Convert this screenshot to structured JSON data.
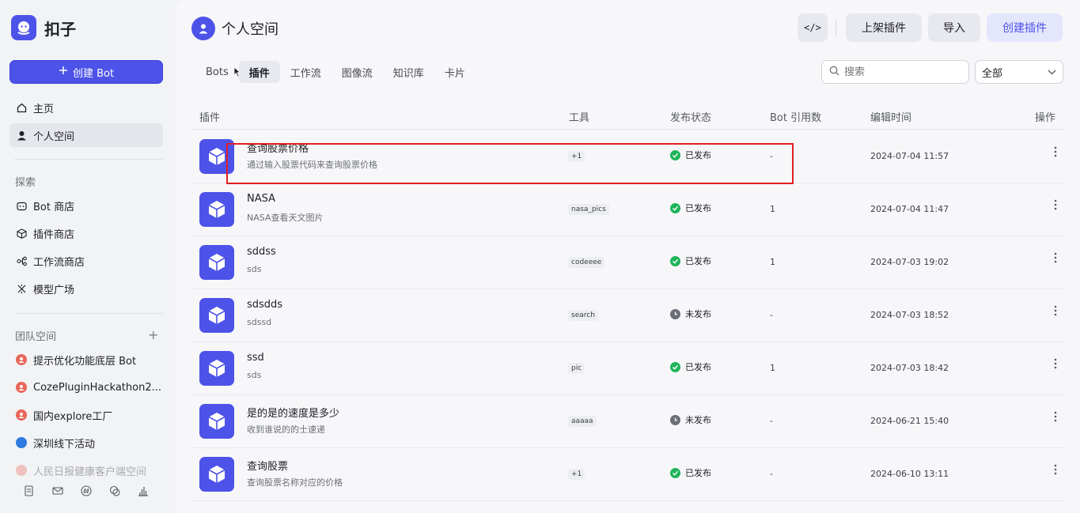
{
  "brand": {
    "name": "扣子"
  },
  "sidebar": {
    "create_bot_label": "创建 Bot",
    "nav": [
      {
        "label": "主页",
        "icon": "home-icon"
      },
      {
        "label": "个人空间",
        "icon": "person-icon",
        "active": true
      }
    ],
    "explore_label": "探索",
    "explore": [
      {
        "label": "Bot 商店",
        "icon": "bot-store-icon"
      },
      {
        "label": "插件商店",
        "icon": "cube-icon"
      },
      {
        "label": "工作流商店",
        "icon": "workflow-icon"
      },
      {
        "label": "模型广场",
        "icon": "model-icon"
      }
    ],
    "team_label": "团队空间",
    "teams": [
      {
        "label": "提示优化功能底层 Bot"
      },
      {
        "label": "CozePluginHackathon2..."
      },
      {
        "label": "国内explore工厂"
      },
      {
        "label": "深圳线下活动"
      },
      {
        "label": "人民日报健康客户端空间"
      }
    ]
  },
  "header": {
    "title": "个人空间",
    "code_btn": "</>",
    "publish_btn": "上架插件",
    "import_btn": "导入",
    "create_btn": "创建插件"
  },
  "tabs": [
    "Bots",
    "插件",
    "工作流",
    "图像流",
    "知识库",
    "卡片"
  ],
  "search": {
    "placeholder": "搜索",
    "value": ""
  },
  "filter": {
    "selected": "全部"
  },
  "table": {
    "columns": [
      "插件",
      "工具",
      "发布状态",
      "Bot 引用数",
      "编辑时间",
      "操作"
    ],
    "rows": [
      {
        "name": "查询股票价格",
        "desc": "通过输入股票代码来查询股票价格",
        "tool": "+1",
        "status": "已发布",
        "published": true,
        "refs": "-",
        "time": "2024-07-04 11:57"
      },
      {
        "name": "NASA",
        "desc": "NASA查看天文图片",
        "tool": "nasa_pics",
        "status": "已发布",
        "published": true,
        "refs": "1",
        "time": "2024-07-04 11:47"
      },
      {
        "name": "sddss",
        "desc": "sds",
        "tool": "codeeee",
        "status": "已发布",
        "published": true,
        "refs": "1",
        "time": "2024-07-03 19:02"
      },
      {
        "name": "sdsdds",
        "desc": "sdssd",
        "tool": "search",
        "status": "未发布",
        "published": false,
        "refs": "-",
        "time": "2024-07-03 18:52"
      },
      {
        "name": "ssd",
        "desc": "sds",
        "tool": "pic",
        "status": "已发布",
        "published": true,
        "refs": "1",
        "time": "2024-07-03 18:42"
      },
      {
        "name": "是的是的速度是多少",
        "desc": "收到谁说的的士速递",
        "tool": "aaaaa",
        "status": "未发布",
        "published": false,
        "refs": "-",
        "time": "2024-06-21 15:40"
      },
      {
        "name": "查询股票",
        "desc": "查询股票名称对应的价格",
        "tool": "+1",
        "status": "已发布",
        "published": true,
        "refs": "-",
        "time": "2024-06-10 13:11"
      }
    ]
  },
  "colors": {
    "accent": "#4d53e8",
    "published": "#1fb45a",
    "unpublished": "#6a6e76",
    "highlight": "#e02020"
  }
}
